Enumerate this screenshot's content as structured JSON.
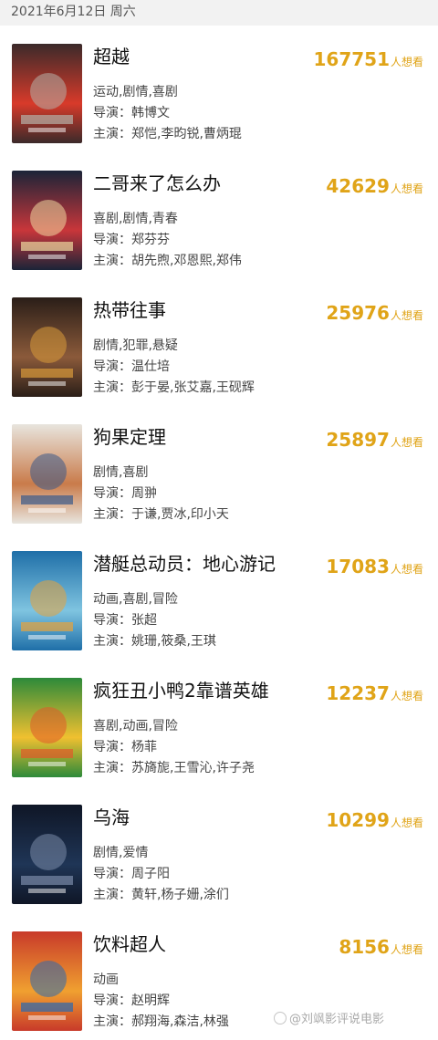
{
  "date_header": "2021年6月12日 周六",
  "movies": [
    {
      "title": "超越",
      "want_count": "167751",
      "unit": "人想看",
      "genre": "运动,剧情,喜剧",
      "director": "导演：韩博文",
      "cast": "主演：郑恺,李昀锐,曹炳琨",
      "poster_colors": [
        "#3b2a2a",
        "#d83a2a",
        "#b5b1a8"
      ]
    },
    {
      "title": "二哥来了怎么办",
      "want_count": "42629",
      "unit": "人想看",
      "genre": "喜剧,剧情,青春",
      "director": "导演：郑芬芬",
      "cast": "主演：胡先煦,邓恩熙,郑伟",
      "poster_colors": [
        "#1b2438",
        "#c9363a",
        "#f0d9a0"
      ]
    },
    {
      "title": "热带往事",
      "want_count": "25976",
      "unit": "人想看",
      "genre": "剧情,犯罪,悬疑",
      "director": "导演：温仕培",
      "cast": "主演：彭于晏,张艾嘉,王砚辉",
      "poster_colors": [
        "#2a1e18",
        "#8b5a3a",
        "#d89a3a"
      ]
    },
    {
      "title": "狗果定理",
      "want_count": "25897",
      "unit": "人想看",
      "genre": "剧情,喜剧",
      "director": "导演：周翀",
      "cast": "主演：于谦,贾冰,印小天",
      "poster_colors": [
        "#e8e5de",
        "#c97b4a",
        "#3a5a8a"
      ]
    },
    {
      "title": "潜艇总动员：地心游记",
      "want_count": "17083",
      "unit": "人想看",
      "genre": "动画,喜剧,冒险",
      "director": "导演：张超",
      "cast": "主演：姚珊,筱桑,王琪",
      "poster_colors": [
        "#1f6fa8",
        "#7fc4e0",
        "#e8a23a"
      ]
    },
    {
      "title": "疯狂丑小鸭2靠谱英雄",
      "want_count": "12237",
      "unit": "人想看",
      "genre": "喜剧,动画,冒险",
      "director": "导演：杨菲",
      "cast": "主演：苏旖旎,王雪沁,许子尧",
      "poster_colors": [
        "#2d8a3a",
        "#f0c030",
        "#e05a2a"
      ]
    },
    {
      "title": "乌海",
      "want_count": "10299",
      "unit": "人想看",
      "genre": "剧情,爱情",
      "director": "导演：周子阳",
      "cast": "主演：黄轩,杨子姗,涂们",
      "poster_colors": [
        "#0f1626",
        "#1f3556",
        "#7a8aa8"
      ]
    },
    {
      "title": "饮料超人",
      "want_count": "8156",
      "unit": "人想看",
      "genre": "动画",
      "director": "导演：赵明辉",
      "cast": "主演：郝翔海,森洁,林强",
      "poster_colors": [
        "#c83a2a",
        "#f0a030",
        "#2a6ab0"
      ]
    }
  ],
  "watermark": "@刘飒影评说电影"
}
